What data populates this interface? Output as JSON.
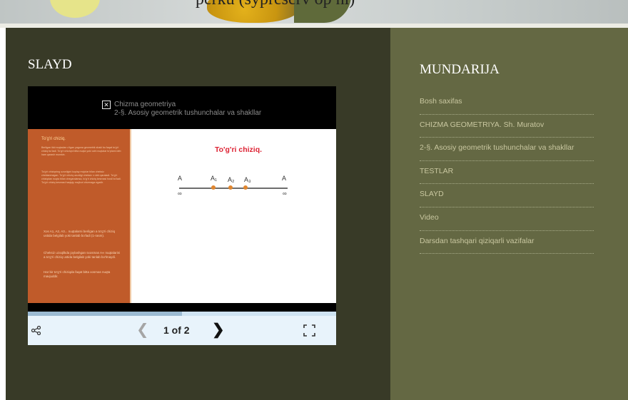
{
  "banner": {
    "caption": "perku (sypreserv op ni)"
  },
  "main": {
    "title": "SLAYD",
    "viewer": {
      "header_line1": "Chizma geometriya",
      "header_line2": "2-§. Asosiy geometrik tushunchalar va shakllar",
      "slide": {
        "panel_title": "To'g'ri chiziq.",
        "panel_text1": "Berilgan ikki nuqtadan o'tgan yagona geometrik shakl bu faqat to'g'ri chiziq bo'ladi. To'g'ri chiziqni bitta nuqta yoki ochi nuqtalar to'plami deb ham qarash mumkin.",
        "panel_text2": "To'g'ri chiziqning uzunligini kuplay mojolar bilan cheksiz cheklanmagan. To'g'ri chiziq uzunligi cheksiz ∞ deb qaraladi. To'g'ri chiziqdan nuqta bilan chegaralansa, to'g'ri chiziq kesmasi hosil bo'ladi. To'g'ri chiziq kesmasi haqiqiy majburi chizmaga egadir.",
        "bullet1": "Xos A1, A2, A3... nuqtalarni berilgan a to'g'ri chiziq ustida belgilab yoki tanlab bo'ladi (1-rasm).",
        "bullet2": "Cheksiz uzoqlikda joylashgan sxosmas A∞ nuqtalarini a to'g'ri chiziq ustida belgilab yoki tanlab bo'lmaydi.",
        "bullet3": "Har bir to'g'ri chiziqda faqat bitta xosmas nuqta mavjuddir.",
        "heading": "To'g'ri chiziq.",
        "points": [
          "A",
          "A₁",
          "A₂",
          "A₃",
          "A"
        ],
        "infinity": "∞"
      },
      "controls": {
        "page_indicator": "1 of 2",
        "progress_fraction": 0.5
      }
    }
  },
  "sidebar": {
    "title": "MUNDARIJA",
    "items": [
      {
        "label": "Bosh saxifas"
      },
      {
        "label": "CHIZMA GEOMETRIYA. Sh. Muratov"
      },
      {
        "label": "2-§. Asosiy geometrik tushunchalar va shakllar"
      },
      {
        "label": "TESTLAR"
      },
      {
        "label": "SLAYD"
      },
      {
        "label": "Video"
      },
      {
        "label": "Darsdan tashqari qiziqarli vazifalar"
      }
    ]
  },
  "colors": {
    "main_bg": "#383a27",
    "sidebar_bg": "#646843",
    "slide_panel": "#c05b2a",
    "slide_heading": "#dd2233",
    "link": "#c9c7a0"
  }
}
